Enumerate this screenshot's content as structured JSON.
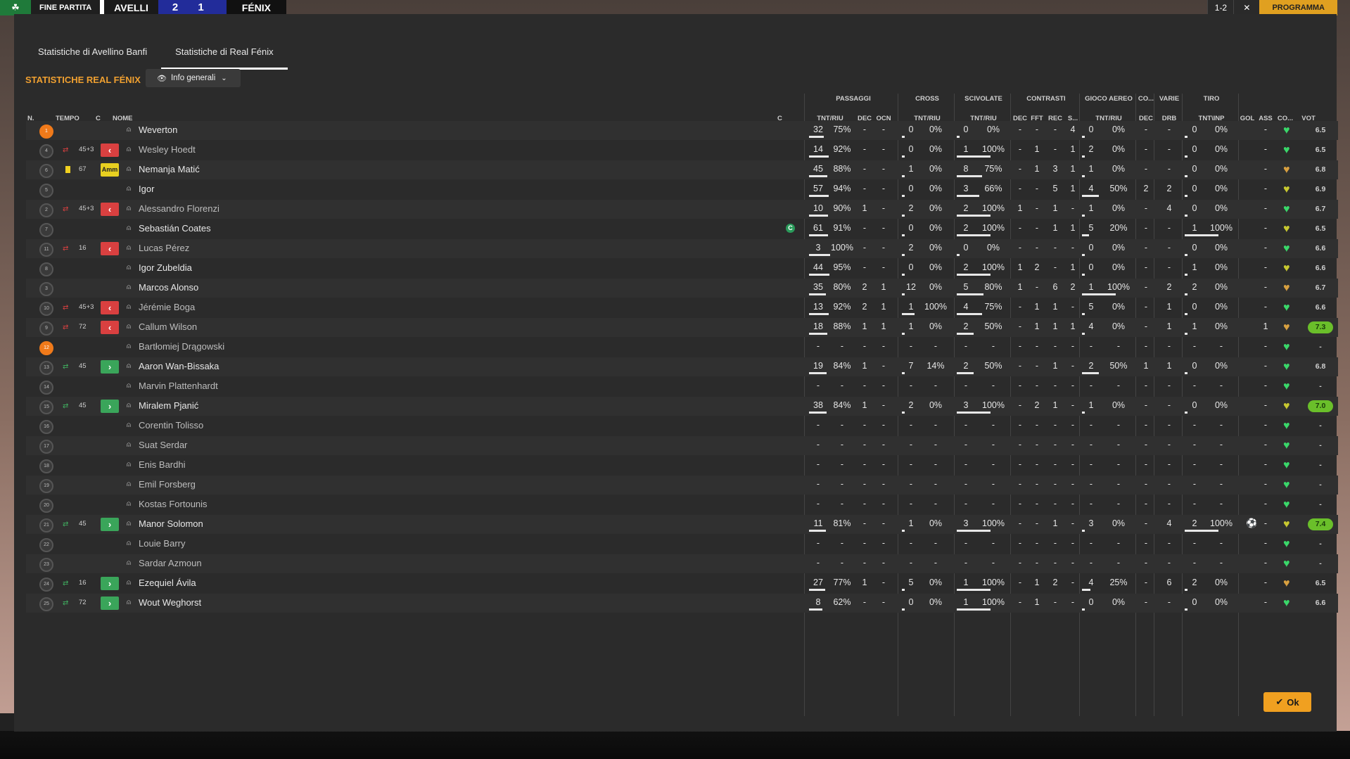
{
  "topbar": {
    "status": "FINE PARTITA",
    "home": "AVELLI",
    "score": "2 1",
    "away": "FÉNIX",
    "right_a": "1-2",
    "right_b": "✕",
    "progress": "PROGRAMMA"
  },
  "tabs": [
    "Statistiche di Avellino Banfi",
    "Statistiche di Real Fénix"
  ],
  "team_title": "STATISTICHE REAL FÉNIX",
  "view_selector": "Info generali",
  "groups": {
    "passaggi": "PASSAGGI",
    "cross": "CROSS",
    "scivolate": "SCIVOLATE",
    "contrasti": "CONTRASTI",
    "gioco_aereo": "GIOCO AEREO",
    "co": "CO...",
    "varie": "VARIE",
    "tiro": "TIRO"
  },
  "headers": {
    "n": "N.",
    "tempo": "TEMPO",
    "c": "C",
    "nome": "NOME",
    "c2": "C",
    "pass_tnt": "TNT/RIU",
    "pass_dec": "DEC",
    "pass_ocn": "OCN",
    "cross_tnt": "TNT/RIU",
    "sciv_tnt": "TNT/RIU",
    "con_dec": "DEC",
    "con_fft": "FFT",
    "con_rec": "REC",
    "con_s": "S...",
    "aereo_tnt": "TNT/RIU",
    "co_dec": "DEC",
    "drb": "DRB",
    "tiro_tnt": "TNT\\INP",
    "gol": "GOL",
    "ass": "ASS",
    "co": "CO...",
    "vot": "VOT"
  },
  "players": [
    {
      "n": "1",
      "gk": true,
      "sub": "",
      "time": "",
      "box": "",
      "name": "Weverton",
      "dim": false,
      "captain": false,
      "pt": "32",
      "pp": "75%",
      "pb": 0.7,
      "pd": "-",
      "po": "-",
      "ct": "0",
      "cp": "0%",
      "cb": 0,
      "st": "0",
      "sp": "0%",
      "sb": 0,
      "k1": "-",
      "k2": "-",
      "k3": "-",
      "k4": "4",
      "at": "0",
      "ap": "0%",
      "ab": 0,
      "cd": "-",
      "dr": "-",
      "tt": "0",
      "tp": "0%",
      "tb": 0,
      "gol": "",
      "ass": "-",
      "heart": "#3ad86a",
      "vote": "6.5",
      "hi": false
    },
    {
      "n": "4",
      "gk": false,
      "sub": "off",
      "time": "45+3",
      "box": "out",
      "name": "Wesley Hoedt",
      "dim": true,
      "captain": false,
      "pt": "14",
      "pp": "92%",
      "pb": 0.92,
      "pd": "-",
      "po": "-",
      "ct": "0",
      "cp": "0%",
      "cb": 0,
      "st": "1",
      "sp": "100%",
      "sb": 1,
      "k1": "-",
      "k2": "1",
      "k3": "-",
      "k4": "1",
      "at": "2",
      "ap": "0%",
      "ab": 0,
      "cd": "-",
      "dr": "-",
      "tt": "0",
      "tp": "0%",
      "tb": 0,
      "gol": "",
      "ass": "-",
      "heart": "#3ad86a",
      "vote": "6.5",
      "hi": false
    },
    {
      "n": "6",
      "gk": false,
      "sub": "card",
      "time": "67",
      "box": "card",
      "name": "Nemanja Matić",
      "dim": false,
      "captain": false,
      "pt": "45",
      "pp": "88%",
      "pb": 0.88,
      "pd": "-",
      "po": "-",
      "ct": "1",
      "cp": "0%",
      "cb": 0,
      "st": "8",
      "sp": "75%",
      "sb": 0.75,
      "k1": "-",
      "k2": "1",
      "k3": "3",
      "k4": "1",
      "at": "1",
      "ap": "0%",
      "ab": 0,
      "cd": "-",
      "dr": "-",
      "tt": "0",
      "tp": "0%",
      "tb": 0,
      "gol": "",
      "ass": "-",
      "heart": "#d8a040",
      "vote": "6.8",
      "hi": false
    },
    {
      "n": "5",
      "gk": false,
      "sub": "",
      "time": "",
      "box": "",
      "name": "Igor",
      "dim": false,
      "captain": false,
      "pt": "57",
      "pp": "94%",
      "pb": 0.94,
      "pd": "-",
      "po": "-",
      "ct": "0",
      "cp": "0%",
      "cb": 0,
      "st": "3",
      "sp": "66%",
      "sb": 0.66,
      "k1": "-",
      "k2": "-",
      "k3": "5",
      "k4": "1",
      "at": "4",
      "ap": "50%",
      "ab": 0.5,
      "cd": "2",
      "dr": "2",
      "tt": "0",
      "tp": "0%",
      "tb": 0,
      "gol": "",
      "ass": "-",
      "heart": "#c8c830",
      "vote": "6.9",
      "hi": false
    },
    {
      "n": "2",
      "gk": false,
      "sub": "off",
      "time": "45+3",
      "box": "out",
      "name": "Alessandro Florenzi",
      "dim": true,
      "captain": false,
      "pt": "10",
      "pp": "90%",
      "pb": 0.9,
      "pd": "1",
      "po": "-",
      "ct": "2",
      "cp": "0%",
      "cb": 0,
      "st": "2",
      "sp": "100%",
      "sb": 1,
      "k1": "1",
      "k2": "-",
      "k3": "1",
      "k4": "-",
      "at": "1",
      "ap": "0%",
      "ab": 0,
      "cd": "-",
      "dr": "4",
      "tt": "0",
      "tp": "0%",
      "tb": 0,
      "gol": "",
      "ass": "-",
      "heart": "#3ad86a",
      "vote": "6.7",
      "hi": false
    },
    {
      "n": "7",
      "gk": false,
      "sub": "",
      "time": "",
      "box": "",
      "name": "Sebastián Coates",
      "dim": false,
      "captain": true,
      "pt": "61",
      "pp": "91%",
      "pb": 0.91,
      "pd": "-",
      "po": "-",
      "ct": "0",
      "cp": "0%",
      "cb": 0,
      "st": "2",
      "sp": "100%",
      "sb": 1,
      "k1": "-",
      "k2": "-",
      "k3": "1",
      "k4": "1",
      "at": "5",
      "ap": "20%",
      "ab": 0.2,
      "cd": "-",
      "dr": "-",
      "tt": "1",
      "tp": "100%",
      "tb": 1,
      "gol": "",
      "ass": "-",
      "heart": "#c8c830",
      "vote": "6.5",
      "hi": false
    },
    {
      "n": "11",
      "gk": false,
      "sub": "off",
      "time": "16",
      "box": "out",
      "name": "Lucas Pérez",
      "dim": true,
      "captain": false,
      "pt": "3",
      "pp": "100%",
      "pb": 1,
      "pd": "-",
      "po": "-",
      "ct": "2",
      "cp": "0%",
      "cb": 0,
      "st": "0",
      "sp": "0%",
      "sb": 0,
      "k1": "-",
      "k2": "-",
      "k3": "-",
      "k4": "-",
      "at": "0",
      "ap": "0%",
      "ab": 0,
      "cd": "-",
      "dr": "-",
      "tt": "0",
      "tp": "0%",
      "tb": 0,
      "gol": "",
      "ass": "-",
      "heart": "#3ad86a",
      "vote": "6.6",
      "hi": false
    },
    {
      "n": "8",
      "gk": false,
      "sub": "",
      "time": "",
      "box": "",
      "name": "Igor Zubeldia",
      "dim": false,
      "captain": false,
      "pt": "44",
      "pp": "95%",
      "pb": 0.95,
      "pd": "-",
      "po": "-",
      "ct": "0",
      "cp": "0%",
      "cb": 0,
      "st": "2",
      "sp": "100%",
      "sb": 1,
      "k1": "1",
      "k2": "2",
      "k3": "-",
      "k4": "1",
      "at": "0",
      "ap": "0%",
      "ab": 0,
      "cd": "-",
      "dr": "-",
      "tt": "1",
      "tp": "0%",
      "tb": 0,
      "gol": "",
      "ass": "-",
      "heart": "#c8c830",
      "vote": "6.6",
      "hi": false
    },
    {
      "n": "3",
      "gk": false,
      "sub": "",
      "time": "",
      "box": "",
      "name": "Marcos Alonso",
      "dim": false,
      "captain": false,
      "pt": "35",
      "pp": "80%",
      "pb": 0.8,
      "pd": "2",
      "po": "1",
      "ct": "12",
      "cp": "0%",
      "cb": 0,
      "st": "5",
      "sp": "80%",
      "sb": 0.8,
      "k1": "1",
      "k2": "-",
      "k3": "6",
      "k4": "2",
      "at": "1",
      "ap": "100%",
      "ab": 1,
      "cd": "-",
      "dr": "2",
      "tt": "2",
      "tp": "0%",
      "tb": 0,
      "gol": "",
      "ass": "-",
      "heart": "#d8a040",
      "vote": "6.7",
      "hi": false
    },
    {
      "n": "10",
      "gk": false,
      "sub": "off",
      "time": "45+3",
      "box": "out",
      "name": "Jérémie Boga",
      "dim": true,
      "captain": false,
      "pt": "13",
      "pp": "92%",
      "pb": 0.92,
      "pd": "2",
      "po": "1",
      "ct": "1",
      "cp": "100%",
      "cb": 1,
      "st": "4",
      "sp": "75%",
      "sb": 0.75,
      "k1": "-",
      "k2": "1",
      "k3": "1",
      "k4": "-",
      "at": "5",
      "ap": "0%",
      "ab": 0,
      "cd": "-",
      "dr": "1",
      "tt": "0",
      "tp": "0%",
      "tb": 0,
      "gol": "",
      "ass": "-",
      "heart": "#3ad86a",
      "vote": "6.6",
      "hi": false
    },
    {
      "n": "9",
      "gk": false,
      "sub": "off",
      "time": "72",
      "box": "out",
      "name": "Callum Wilson",
      "dim": true,
      "captain": false,
      "pt": "18",
      "pp": "88%",
      "pb": 0.88,
      "pd": "1",
      "po": "1",
      "ct": "1",
      "cp": "0%",
      "cb": 0,
      "st": "2",
      "sp": "50%",
      "sb": 0.5,
      "k1": "-",
      "k2": "1",
      "k3": "1",
      "k4": "1",
      "at": "4",
      "ap": "0%",
      "ab": 0,
      "cd": "-",
      "dr": "1",
      "tt": "1",
      "tp": "0%",
      "tb": 0,
      "gol": "",
      "ass": "1",
      "heart": "#d8a040",
      "vote": "7.3",
      "hi": true
    },
    {
      "n": "12",
      "gk": true,
      "sub": "",
      "time": "",
      "box": "",
      "name": "Bartłomiej Drągowski",
      "dim": true,
      "captain": false,
      "pt": "-",
      "pp": "-",
      "pb": 0,
      "pd": "-",
      "po": "-",
      "ct": "-",
      "cp": "-",
      "cb": 0,
      "st": "-",
      "sp": "-",
      "sb": 0,
      "k1": "-",
      "k2": "-",
      "k3": "-",
      "k4": "-",
      "at": "-",
      "ap": "-",
      "ab": 0,
      "cd": "-",
      "dr": "-",
      "tt": "-",
      "tp": "-",
      "tb": 0,
      "gol": "",
      "ass": "-",
      "heart": "#3ad86a",
      "vote": "-",
      "hi": false
    },
    {
      "n": "13",
      "gk": false,
      "sub": "on",
      "time": "45",
      "box": "in",
      "name": "Aaron Wan-Bissaka",
      "dim": false,
      "captain": false,
      "pt": "19",
      "pp": "84%",
      "pb": 0.84,
      "pd": "1",
      "po": "-",
      "ct": "7",
      "cp": "14%",
      "cb": 0.14,
      "st": "2",
      "sp": "50%",
      "sb": 0.5,
      "k1": "-",
      "k2": "-",
      "k3": "1",
      "k4": "-",
      "at": "2",
      "ap": "50%",
      "ab": 0.5,
      "cd": "1",
      "dr": "1",
      "tt": "0",
      "tp": "0%",
      "tb": 0,
      "gol": "",
      "ass": "-",
      "heart": "#3ad86a",
      "vote": "6.8",
      "hi": false
    },
    {
      "n": "14",
      "gk": false,
      "sub": "",
      "time": "",
      "box": "",
      "name": "Marvin Plattenhardt",
      "dim": true,
      "captain": false,
      "pt": "-",
      "pp": "-",
      "pb": 0,
      "pd": "-",
      "po": "-",
      "ct": "-",
      "cp": "-",
      "cb": 0,
      "st": "-",
      "sp": "-",
      "sb": 0,
      "k1": "-",
      "k2": "-",
      "k3": "-",
      "k4": "-",
      "at": "-",
      "ap": "-",
      "ab": 0,
      "cd": "-",
      "dr": "-",
      "tt": "-",
      "tp": "-",
      "tb": 0,
      "gol": "",
      "ass": "-",
      "heart": "#3ad86a",
      "vote": "-",
      "hi": false
    },
    {
      "n": "15",
      "gk": false,
      "sub": "on",
      "time": "45",
      "box": "in",
      "name": "Miralem Pjanić",
      "dim": false,
      "captain": false,
      "pt": "38",
      "pp": "84%",
      "pb": 0.84,
      "pd": "1",
      "po": "-",
      "ct": "2",
      "cp": "0%",
      "cb": 0,
      "st": "3",
      "sp": "100%",
      "sb": 1,
      "k1": "-",
      "k2": "2",
      "k3": "1",
      "k4": "-",
      "at": "1",
      "ap": "0%",
      "ab": 0,
      "cd": "-",
      "dr": "-",
      "tt": "0",
      "tp": "0%",
      "tb": 0,
      "gol": "",
      "ass": "-",
      "heart": "#c8c830",
      "vote": "7.0",
      "hi": true
    },
    {
      "n": "16",
      "gk": false,
      "sub": "",
      "time": "",
      "box": "",
      "name": "Corentin Tolisso",
      "dim": true,
      "captain": false,
      "pt": "-",
      "pp": "-",
      "pb": 0,
      "pd": "-",
      "po": "-",
      "ct": "-",
      "cp": "-",
      "cb": 0,
      "st": "-",
      "sp": "-",
      "sb": 0,
      "k1": "-",
      "k2": "-",
      "k3": "-",
      "k4": "-",
      "at": "-",
      "ap": "-",
      "ab": 0,
      "cd": "-",
      "dr": "-",
      "tt": "-",
      "tp": "-",
      "tb": 0,
      "gol": "",
      "ass": "-",
      "heart": "#3ad86a",
      "vote": "-",
      "hi": false
    },
    {
      "n": "17",
      "gk": false,
      "sub": "",
      "time": "",
      "box": "",
      "name": "Suat Serdar",
      "dim": true,
      "captain": false,
      "pt": "-",
      "pp": "-",
      "pb": 0,
      "pd": "-",
      "po": "-",
      "ct": "-",
      "cp": "-",
      "cb": 0,
      "st": "-",
      "sp": "-",
      "sb": 0,
      "k1": "-",
      "k2": "-",
      "k3": "-",
      "k4": "-",
      "at": "-",
      "ap": "-",
      "ab": 0,
      "cd": "-",
      "dr": "-",
      "tt": "-",
      "tp": "-",
      "tb": 0,
      "gol": "",
      "ass": "-",
      "heart": "#3ad86a",
      "vote": "-",
      "hi": false
    },
    {
      "n": "18",
      "gk": false,
      "sub": "",
      "time": "",
      "box": "",
      "name": "Enis Bardhi",
      "dim": true,
      "captain": false,
      "pt": "-",
      "pp": "-",
      "pb": 0,
      "pd": "-",
      "po": "-",
      "ct": "-",
      "cp": "-",
      "cb": 0,
      "st": "-",
      "sp": "-",
      "sb": 0,
      "k1": "-",
      "k2": "-",
      "k3": "-",
      "k4": "-",
      "at": "-",
      "ap": "-",
      "ab": 0,
      "cd": "-",
      "dr": "-",
      "tt": "-",
      "tp": "-",
      "tb": 0,
      "gol": "",
      "ass": "-",
      "heart": "#3ad86a",
      "vote": "-",
      "hi": false
    },
    {
      "n": "19",
      "gk": false,
      "sub": "",
      "time": "",
      "box": "",
      "name": "Emil Forsberg",
      "dim": true,
      "captain": false,
      "pt": "-",
      "pp": "-",
      "pb": 0,
      "pd": "-",
      "po": "-",
      "ct": "-",
      "cp": "-",
      "cb": 0,
      "st": "-",
      "sp": "-",
      "sb": 0,
      "k1": "-",
      "k2": "-",
      "k3": "-",
      "k4": "-",
      "at": "-",
      "ap": "-",
      "ab": 0,
      "cd": "-",
      "dr": "-",
      "tt": "-",
      "tp": "-",
      "tb": 0,
      "gol": "",
      "ass": "-",
      "heart": "#3ad86a",
      "vote": "-",
      "hi": false
    },
    {
      "n": "20",
      "gk": false,
      "sub": "",
      "time": "",
      "box": "",
      "name": "Kostas Fortounis",
      "dim": true,
      "captain": false,
      "pt": "-",
      "pp": "-",
      "pb": 0,
      "pd": "-",
      "po": "-",
      "ct": "-",
      "cp": "-",
      "cb": 0,
      "st": "-",
      "sp": "-",
      "sb": 0,
      "k1": "-",
      "k2": "-",
      "k3": "-",
      "k4": "-",
      "at": "-",
      "ap": "-",
      "ab": 0,
      "cd": "-",
      "dr": "-",
      "tt": "-",
      "tp": "-",
      "tb": 0,
      "gol": "",
      "ass": "-",
      "heart": "#3ad86a",
      "vote": "-",
      "hi": false
    },
    {
      "n": "21",
      "gk": false,
      "sub": "on",
      "time": "45",
      "box": "in",
      "name": "Manor Solomon",
      "dim": false,
      "captain": false,
      "pt": "11",
      "pp": "81%",
      "pb": 0.81,
      "pd": "-",
      "po": "-",
      "ct": "1",
      "cp": "0%",
      "cb": 0,
      "st": "3",
      "sp": "100%",
      "sb": 1,
      "k1": "-",
      "k2": "-",
      "k3": "1",
      "k4": "-",
      "at": "3",
      "ap": "0%",
      "ab": 0,
      "cd": "-",
      "dr": "4",
      "tt": "2",
      "tp": "100%",
      "tb": 1,
      "gol": "ball",
      "ass": "-",
      "heart": "#c8c830",
      "vote": "7.4",
      "hi": true
    },
    {
      "n": "22",
      "gk": false,
      "sub": "",
      "time": "",
      "box": "",
      "name": "Louie Barry",
      "dim": true,
      "captain": false,
      "pt": "-",
      "pp": "-",
      "pb": 0,
      "pd": "-",
      "po": "-",
      "ct": "-",
      "cp": "-",
      "cb": 0,
      "st": "-",
      "sp": "-",
      "sb": 0,
      "k1": "-",
      "k2": "-",
      "k3": "-",
      "k4": "-",
      "at": "-",
      "ap": "-",
      "ab": 0,
      "cd": "-",
      "dr": "-",
      "tt": "-",
      "tp": "-",
      "tb": 0,
      "gol": "",
      "ass": "-",
      "heart": "#3ad86a",
      "vote": "-",
      "hi": false
    },
    {
      "n": "23",
      "gk": false,
      "sub": "",
      "time": "",
      "box": "",
      "name": "Sardar Azmoun",
      "dim": true,
      "captain": false,
      "pt": "-",
      "pp": "-",
      "pb": 0,
      "pd": "-",
      "po": "-",
      "ct": "-",
      "cp": "-",
      "cb": 0,
      "st": "-",
      "sp": "-",
      "sb": 0,
      "k1": "-",
      "k2": "-",
      "k3": "-",
      "k4": "-",
      "at": "-",
      "ap": "-",
      "ab": 0,
      "cd": "-",
      "dr": "-",
      "tt": "-",
      "tp": "-",
      "tb": 0,
      "gol": "",
      "ass": "-",
      "heart": "#3ad86a",
      "vote": "-",
      "hi": false
    },
    {
      "n": "24",
      "gk": false,
      "sub": "on",
      "time": "16",
      "box": "in",
      "name": "Ezequiel Ávila",
      "dim": false,
      "captain": false,
      "pt": "27",
      "pp": "77%",
      "pb": 0.77,
      "pd": "1",
      "po": "-",
      "ct": "5",
      "cp": "0%",
      "cb": 0,
      "st": "1",
      "sp": "100%",
      "sb": 1,
      "k1": "-",
      "k2": "1",
      "k3": "2",
      "k4": "-",
      "at": "4",
      "ap": "25%",
      "ab": 0.25,
      "cd": "-",
      "dr": "6",
      "tt": "2",
      "tp": "0%",
      "tb": 0,
      "gol": "",
      "ass": "-",
      "heart": "#d8a040",
      "vote": "6.5",
      "hi": false
    },
    {
      "n": "25",
      "gk": false,
      "sub": "on",
      "time": "72",
      "box": "in",
      "name": "Wout Weghorst",
      "dim": false,
      "captain": false,
      "pt": "8",
      "pp": "62%",
      "pb": 0.62,
      "pd": "-",
      "po": "-",
      "ct": "0",
      "cp": "0%",
      "cb": 0,
      "st": "1",
      "sp": "100%",
      "sb": 1,
      "k1": "-",
      "k2": "1",
      "k3": "-",
      "k4": "-",
      "at": "0",
      "ap": "0%",
      "ab": 0,
      "cd": "-",
      "dr": "-",
      "tt": "0",
      "tp": "0%",
      "tb": 0,
      "gol": "",
      "ass": "-",
      "heart": "#3ad86a",
      "vote": "6.6",
      "hi": false
    }
  ],
  "captain_mark": "C",
  "card_label": "Amm",
  "ok_label": "Ok",
  "colors": {
    "accent": "#f0a020",
    "sub_off": "#d94040",
    "sub_on": "#3aa55a",
    "vote_high": "#6abf2a"
  }
}
